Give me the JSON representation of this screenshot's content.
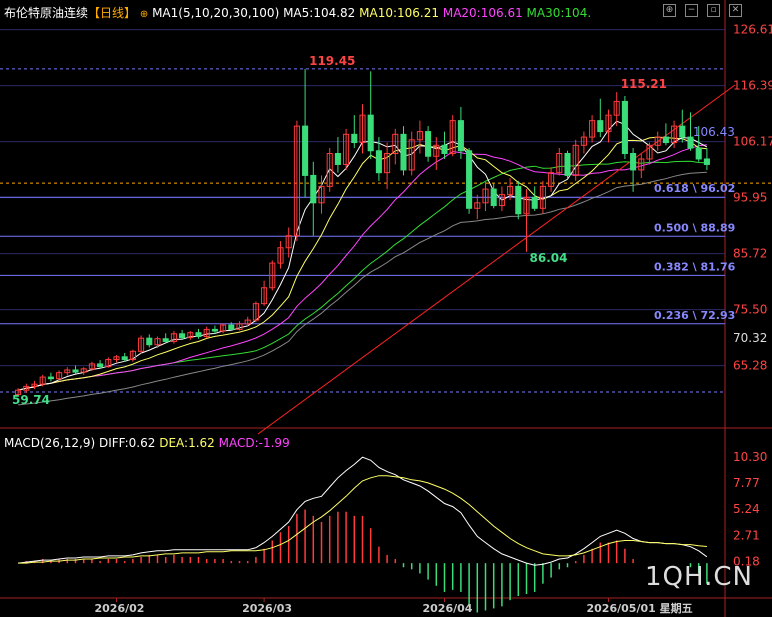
{
  "header": {
    "title": "布伦特原油连续",
    "period": "【日线】",
    "ma_label": "MA1(5,10,20,30,100)",
    "ma5": "MA5:104.82",
    "ma10": "MA10:106.21",
    "ma20": "MA20:106.61",
    "ma30": "MA30:104.",
    "icons": [
      "target-icon",
      "minus-icon",
      "restore-icon",
      "close-icon"
    ]
  },
  "macd_header": {
    "label": "MACD(26,12,9)",
    "diff": "DIFF:0.62",
    "dea": "DEA:1.62",
    "macd": "MACD:-1.99"
  },
  "watermark": "1QH.CN",
  "colors": {
    "up": "#ff3b3b",
    "down": "#3bdc7a",
    "ma5": "#ffffff",
    "ma10": "#ffff66",
    "ma20": "#ff44ff",
    "ma30": "#33dd33",
    "ma100": "#888888",
    "fib": "#7777ff",
    "trend": "#ff2222"
  },
  "chart_data": [
    {
      "type": "candlestick",
      "title": "布伦特原油连续【日线】",
      "ylim": [
        55,
        128
      ],
      "price_axis_ticks": [
        "126.61",
        "116.39",
        "106.17",
        "95.95",
        "85.72",
        "75.50",
        "70.32",
        "65.28"
      ],
      "current_price_label": "70.32",
      "x_axis_labels": [
        "2026/02",
        "2026/03",
        "2026/04",
        "2026/05/01 星期五"
      ],
      "annotations": {
        "high": "119.45",
        "high2": "115.21",
        "last_ma": "106.43",
        "low_start": "59.74",
        "low_mid": "86.04"
      },
      "fibonacci": [
        {
          "label": "0.618 \\ 96.02",
          "value": 96.02
        },
        {
          "label": "0.500 \\ 88.89",
          "value": 88.89
        },
        {
          "label": "0.382 \\ 81.76",
          "value": 81.76
        },
        {
          "label": "0.236 \\ 72.93",
          "value": 72.93
        }
      ],
      "moving_averages": [
        "MA5",
        "MA10",
        "MA20",
        "MA30",
        "MA100"
      ],
      "candles": [
        [
          60.0,
          61.2,
          59.7,
          60.8
        ],
        [
          60.8,
          62.0,
          60.3,
          61.5
        ],
        [
          61.5,
          62.5,
          61.0,
          61.9
        ],
        [
          61.9,
          63.6,
          61.5,
          63.2
        ],
        [
          63.2,
          64.0,
          62.4,
          62.9
        ],
        [
          62.9,
          64.4,
          62.6,
          64.0
        ],
        [
          64.0,
          65.0,
          63.5,
          64.5
        ],
        [
          64.5,
          65.3,
          63.8,
          64.1
        ],
        [
          64.1,
          65.0,
          63.6,
          64.7
        ],
        [
          64.7,
          66.0,
          64.3,
          65.6
        ],
        [
          65.6,
          66.3,
          64.8,
          65.1
        ],
        [
          65.1,
          66.8,
          64.9,
          66.4
        ],
        [
          66.4,
          67.2,
          65.9,
          66.9
        ],
        [
          66.9,
          67.6,
          66.0,
          66.4
        ],
        [
          66.4,
          68.2,
          66.0,
          67.9
        ],
        [
          67.9,
          70.8,
          67.5,
          70.3
        ],
        [
          70.3,
          71.0,
          68.6,
          69.1
        ],
        [
          69.1,
          70.6,
          68.5,
          70.2
        ],
        [
          70.2,
          71.2,
          69.4,
          69.7
        ],
        [
          69.7,
          71.6,
          69.3,
          71.1
        ],
        [
          71.1,
          71.8,
          70.0,
          70.4
        ],
        [
          70.4,
          71.6,
          70.0,
          71.3
        ],
        [
          71.3,
          72.0,
          70.2,
          70.6
        ],
        [
          70.6,
          72.4,
          70.3,
          71.9
        ],
        [
          71.9,
          72.6,
          71.1,
          71.6
        ],
        [
          71.6,
          73.0,
          71.2,
          72.7
        ],
        [
          72.7,
          73.2,
          71.6,
          71.9
        ],
        [
          71.9,
          73.4,
          71.7,
          72.9
        ],
        [
          72.9,
          74.2,
          72.5,
          73.6
        ],
        [
          73.6,
          77.0,
          73.2,
          76.6
        ],
        [
          76.6,
          80.8,
          76.2,
          79.5
        ],
        [
          79.5,
          84.5,
          79.0,
          84.0
        ],
        [
          84.0,
          88.0,
          83.0,
          86.8
        ],
        [
          86.8,
          90.5,
          85.0,
          89.0
        ],
        [
          89.0,
          110.0,
          88.0,
          109.0
        ],
        [
          109.0,
          119.45,
          96.0,
          100.0
        ],
        [
          100.0,
          102.5,
          89.0,
          95.0
        ],
        [
          95.0,
          100.0,
          93.0,
          98.0
        ],
        [
          98.0,
          105.0,
          97.0,
          104.0
        ],
        [
          104.0,
          107.0,
          100.5,
          102.0
        ],
        [
          102.0,
          108.5,
          101.0,
          107.5
        ],
        [
          107.5,
          111.0,
          105.0,
          106.0
        ],
        [
          106.0,
          113.0,
          104.0,
          111.0
        ],
        [
          111.0,
          119.0,
          103.0,
          104.5
        ],
        [
          104.5,
          107.0,
          99.0,
          100.5
        ],
        [
          100.5,
          106.0,
          97.5,
          104.0
        ],
        [
          104.0,
          108.5,
          102.0,
          107.5
        ],
        [
          107.5,
          109.0,
          100.0,
          101.0
        ],
        [
          101.0,
          108.0,
          100.0,
          106.5
        ],
        [
          106.5,
          110.0,
          104.0,
          108.0
        ],
        [
          108.0,
          109.0,
          102.5,
          103.5
        ],
        [
          103.5,
          107.0,
          101.0,
          105.5
        ],
        [
          105.5,
          108.0,
          103.0,
          104.0
        ],
        [
          104.0,
          111.0,
          103.5,
          110.0
        ],
        [
          110.0,
          112.5,
          103.0,
          104.5
        ],
        [
          104.5,
          105.0,
          93.0,
          94.0
        ],
        [
          94.0,
          96.5,
          92.0,
          95.0
        ],
        [
          95.0,
          99.0,
          93.5,
          97.5
        ],
        [
          97.5,
          98.5,
          94.0,
          94.5
        ],
        [
          94.5,
          98.0,
          93.5,
          96.5
        ],
        [
          96.5,
          99.5,
          95.5,
          98.0
        ],
        [
          98.0,
          99.0,
          92.0,
          93.0
        ],
        [
          93.0,
          97.5,
          86.04,
          96.0
        ],
        [
          96.0,
          98.0,
          93.5,
          94.0
        ],
        [
          94.0,
          99.0,
          93.0,
          98.0
        ],
        [
          98.0,
          101.5,
          97.0,
          100.5
        ],
        [
          100.5,
          105.0,
          100.0,
          104.0
        ],
        [
          104.0,
          104.5,
          99.5,
          100.0
        ],
        [
          100.0,
          106.5,
          99.0,
          105.5
        ],
        [
          105.5,
          108.0,
          104.0,
          107.0
        ],
        [
          107.0,
          111.0,
          106.0,
          110.0
        ],
        [
          110.0,
          114.0,
          107.0,
          108.0
        ],
        [
          108.0,
          112.0,
          106.0,
          111.0
        ],
        [
          111.0,
          115.21,
          109.0,
          113.5
        ],
        [
          113.5,
          114.5,
          103.0,
          104.0
        ],
        [
          104.0,
          105.0,
          97.0,
          101.0
        ],
        [
          101.0,
          104.0,
          99.5,
          103.0
        ],
        [
          103.0,
          106.0,
          102.0,
          105.5
        ],
        [
          105.5,
          108.0,
          104.5,
          107.0
        ],
        [
          107.0,
          109.5,
          105.5,
          106.0
        ],
        [
          106.0,
          110.0,
          105.0,
          109.0
        ],
        [
          109.0,
          112.0,
          106.0,
          107.0
        ],
        [
          107.0,
          111.5,
          104.5,
          105.0
        ],
        [
          105.0,
          109.0,
          102.5,
          103.0
        ],
        [
          103.0,
          105.0,
          101.0,
          102.0
        ]
      ]
    },
    {
      "type": "macd",
      "title": "MACD(26,12,9)",
      "axis_ticks": [
        "10.30",
        "7.77",
        "5.24",
        "2.71",
        "0.18"
      ],
      "diff": [
        0.0,
        0.1,
        0.2,
        0.3,
        0.3,
        0.4,
        0.5,
        0.5,
        0.6,
        0.6,
        0.6,
        0.7,
        0.7,
        0.7,
        0.8,
        1.0,
        1.1,
        1.2,
        1.2,
        1.3,
        1.3,
        1.3,
        1.3,
        1.3,
        1.3,
        1.3,
        1.3,
        1.3,
        1.3,
        1.5,
        2.0,
        2.6,
        3.3,
        4.0,
        5.2,
        6.0,
        6.3,
        6.5,
        7.4,
        8.3,
        9.0,
        9.6,
        10.3,
        10.0,
        9.3,
        8.9,
        8.6,
        8.1,
        7.8,
        7.5,
        7.0,
        6.4,
        5.8,
        5.5,
        4.9,
        3.7,
        2.6,
        2.0,
        1.4,
        0.9,
        0.6,
        0.3,
        0.0,
        -0.2,
        -0.1,
        0.1,
        0.4,
        0.5,
        0.9,
        1.4,
        2.0,
        2.6,
        2.9,
        3.2,
        2.9,
        2.4,
        2.1,
        2.0,
        2.0,
        1.9,
        1.9,
        1.8,
        1.6,
        1.2,
        0.62
      ],
      "dea": [
        0.0,
        0.0,
        0.1,
        0.1,
        0.2,
        0.2,
        0.3,
        0.3,
        0.4,
        0.4,
        0.5,
        0.5,
        0.5,
        0.6,
        0.6,
        0.7,
        0.7,
        0.8,
        0.9,
        0.9,
        1.0,
        1.0,
        1.0,
        1.1,
        1.1,
        1.1,
        1.2,
        1.2,
        1.2,
        1.2,
        1.3,
        1.5,
        1.8,
        2.2,
        2.8,
        3.4,
        4.0,
        4.5,
        5.1,
        5.8,
        6.5,
        7.3,
        8.0,
        8.3,
        8.5,
        8.5,
        8.4,
        8.3,
        8.1,
        8.0,
        7.8,
        7.5,
        7.2,
        6.8,
        6.3,
        5.7,
        5.0,
        4.3,
        3.6,
        3.0,
        2.4,
        1.9,
        1.5,
        1.2,
        0.9,
        0.8,
        0.7,
        0.7,
        0.8,
        1.0,
        1.3,
        1.6,
        1.9,
        2.1,
        2.2,
        2.2,
        2.1,
        2.0,
        2.0,
        1.9,
        1.9,
        1.8,
        1.8,
        1.7,
        1.62
      ],
      "hist": "2 * (diff - dea)"
    }
  ]
}
